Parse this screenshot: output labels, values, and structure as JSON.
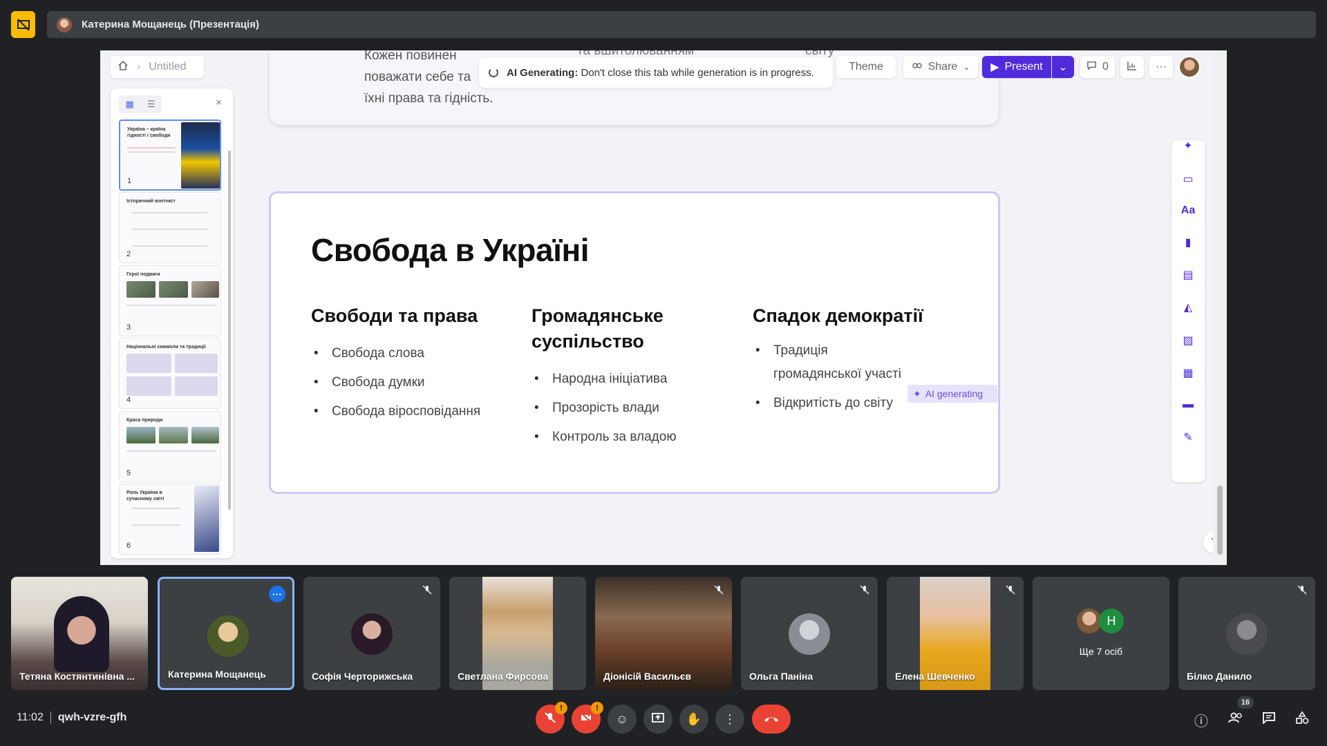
{
  "top_bar": {
    "presenter_title": "Катерина Мощанець (Презентація)"
  },
  "editor": {
    "breadcrumb_label": "Untitled",
    "toast_bold": "AI Generating:",
    "toast_text": "Don't close this tab while generation is in progress.",
    "theme_label": "Theme",
    "share_label": "Share",
    "present_label": "Present",
    "comment_count": "0",
    "help_label": "?"
  },
  "previous_slide": {
    "text_lines": [
      "Кожен повинен",
      "поважати себе та",
      "їхні права та гідність."
    ],
    "fragment_2": "та вшитолюванням",
    "fragment_3": "світу"
  },
  "thumbnails": [
    {
      "num": "1",
      "title": "Україна – країна гідності і свободи"
    },
    {
      "num": "2",
      "title": "Історичний контекст"
    },
    {
      "num": "3",
      "title": "Герої подвиги"
    },
    {
      "num": "4",
      "title": "Національні символи та традиції"
    },
    {
      "num": "5",
      "title": "Краса природи"
    },
    {
      "num": "6",
      "title": "Роль України в сучасному світі"
    }
  ],
  "slide": {
    "title": "Свобода в Україні",
    "columns": [
      {
        "heading": "Свободи та права",
        "items": [
          "Свобода слова",
          "Свобода думки",
          "Свобода віросповідання"
        ]
      },
      {
        "heading": "Громадянське суспільство",
        "items": [
          "Народна ініціатива",
          "Прозорість влади",
          "Контроль за владою"
        ]
      },
      {
        "heading": "Спадок демократії",
        "items": [
          "Традиція громадянської участі",
          "Відкритість до світу"
        ]
      }
    ],
    "ai_chip": "AI generating"
  },
  "participants": [
    {
      "name": "Тетяна Костянтинівна ..."
    },
    {
      "name": "Катерина Мощанець"
    },
    {
      "name": "Софія Черторижська"
    },
    {
      "name": "Светлана Фирсова"
    },
    {
      "name": "Діонісій Васильєв"
    },
    {
      "name": "Ольга Паніна"
    },
    {
      "name": "Елена Шевченко"
    },
    {
      "name": "Ще 7 осіб",
      "avatar_letter": "Н"
    },
    {
      "name": "Білко Данило"
    }
  ],
  "bottom_bar": {
    "time": "11:02",
    "meeting_code": "qwh-vzre-gfh",
    "people_count": "16",
    "warn_mark": "!"
  },
  "colors": {
    "accent": "#4f2bdb",
    "meet_bg": "#202124",
    "leave_red": "#ea4335",
    "badge_yellow": "#fbbc04"
  },
  "icons": [
    "present-off-icon",
    "home-icon",
    "chevron-right-icon",
    "spinner-icon",
    "share-icon",
    "chevron-down-icon",
    "play-icon",
    "comment-icon",
    "chart-icon",
    "more-icon",
    "ai-sparkle-icon",
    "mic-off-icon",
    "cam-off-icon",
    "emoji-icon",
    "present-screen-icon",
    "raise-hand-icon",
    "more-vert-icon",
    "call-end-icon",
    "info-icon",
    "people-icon",
    "chat-icon",
    "activities-icon"
  ]
}
